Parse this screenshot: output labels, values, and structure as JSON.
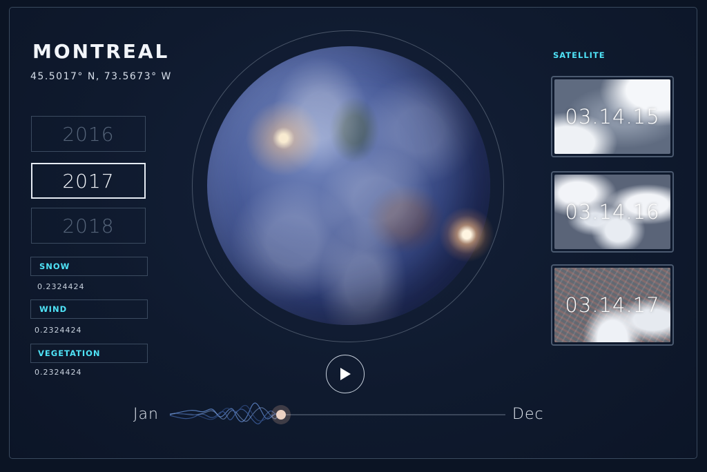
{
  "location": {
    "city": "MONTREAL",
    "coordinates": "45.5017° N, 73.5673° W"
  },
  "years": [
    {
      "label": "2016",
      "active": false
    },
    {
      "label": "2017",
      "active": true
    },
    {
      "label": "2018",
      "active": false
    }
  ],
  "metrics": [
    {
      "label": "SNOW",
      "value": "0.2324424"
    },
    {
      "label": "WIND",
      "value": "0.2324424"
    },
    {
      "label": "VEGETATION",
      "value": "0.2324424"
    }
  ],
  "satellite": {
    "title": "SATELLITE",
    "images": [
      {
        "date": "03.14.15"
      },
      {
        "date": "03.14.16"
      },
      {
        "date": "03.14.17"
      }
    ]
  },
  "timeline": {
    "start_label": "Jan",
    "end_label": "Dec",
    "progress": 0.29
  },
  "colors": {
    "accent_cyan": "#4fe3f7",
    "background": "#0b1424",
    "border": "#3b4b60",
    "glow": "#ffc28a"
  },
  "icons": {
    "play": "play-icon"
  }
}
